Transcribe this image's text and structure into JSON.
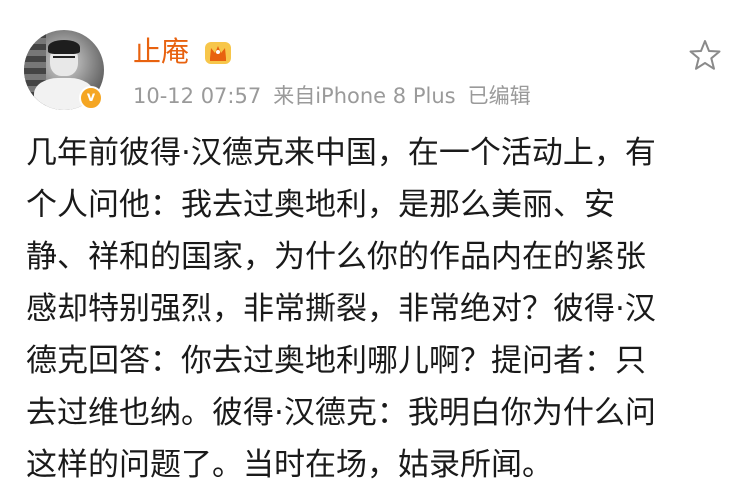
{
  "post": {
    "author": "止庵",
    "timestamp": "10-12 07:57",
    "source": "来自iPhone 8 Plus",
    "edited": "已编辑",
    "icons": {
      "avatar": "avatar",
      "verified": "verified-badge-icon",
      "vip": "crown-icon",
      "favorite": "star-icon"
    },
    "colors": {
      "author": "#e8620f",
      "meta": "#9a9a9a",
      "verified": "#f5a623",
      "text": "#1a1a1a"
    },
    "content_lines": [
      "几年前彼得·汉德克来中国，在一个活动上，有",
      "个人问他：我去过奥地利，是那么美丽、安",
      "静、祥和的国家，为什么你的作品内在的紧张",
      "感却特别强烈，非常撕裂，非常绝对？彼得·汉",
      "德克回答：你去过奥地利哪儿啊？提问者：只",
      "去过维也纳。彼得·汉德克：我明白你为什么问",
      "这样的问题了。当时在场，姑录所闻。"
    ]
  }
}
